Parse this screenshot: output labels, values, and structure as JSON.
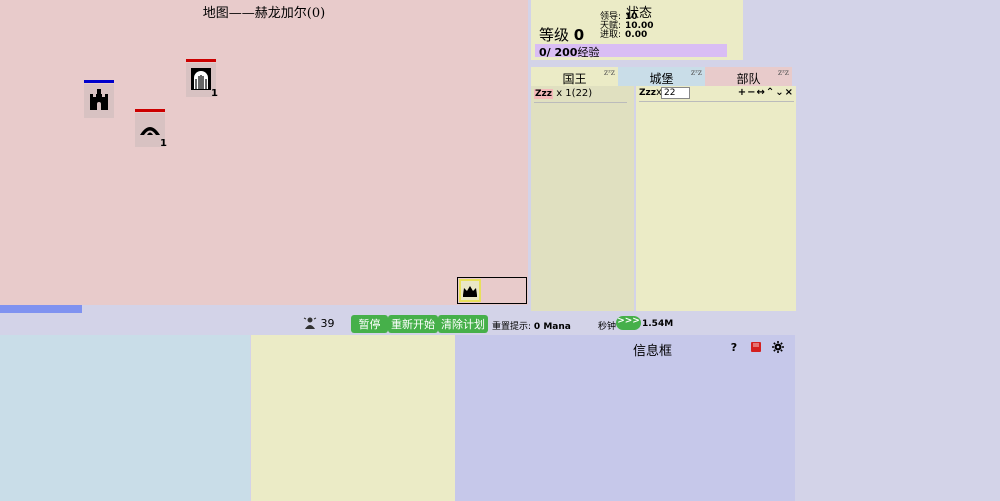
{
  "map": {
    "title": "地图——赫龙加尔(0)",
    "progress_percent": 15.5
  },
  "units": [
    {
      "kind": "castle",
      "bar_color": "#0000cc",
      "count": ""
    },
    {
      "kind": "gate",
      "bar_color": "#cc0000",
      "count": "1"
    },
    {
      "kind": "arch",
      "bar_color": "#cc0000",
      "count": "1"
    }
  ],
  "status": {
    "title": "状态",
    "level_label": "等级",
    "level_value": "0",
    "leadership_label": "领导:",
    "leadership_value": "10",
    "talent_label": "天赋:",
    "talent_value": "10.00",
    "progress_label": "进取:",
    "progress_value": "0.00",
    "exp_current": "0/ 200",
    "exp_label": "经验"
  },
  "tabs": [
    {
      "label": "国王",
      "sleep": "zᶻz"
    },
    {
      "label": "城堡",
      "sleep": "zᶻz"
    },
    {
      "label": "部队",
      "sleep": "zᶻz"
    }
  ],
  "king_list": {
    "sleep_icon": "Zzz",
    "row_text": "x  1(22)"
  },
  "castle_list": {
    "sleep_icon": "Zzz",
    "x_label": "x",
    "input_value": "22",
    "controls": "+−↔⌃⌄×"
  },
  "controls": {
    "population": "39",
    "pause": "暂停",
    "restart": "重新开始",
    "clear_plan": "清除计划",
    "reset_hint_label": "重置提示:",
    "reset_hint_value": "0 Mana",
    "clock_label": "秒钟",
    "fast_forward": ">>>",
    "speed_value": "1.54M"
  },
  "info": {
    "title": "信息框",
    "help": "?",
    "book_color": "#d42020"
  },
  "colors": {
    "map_bg": "#e8cbcb",
    "accent_green": "#46b04a",
    "exp_purple": "#d9bdf4"
  }
}
